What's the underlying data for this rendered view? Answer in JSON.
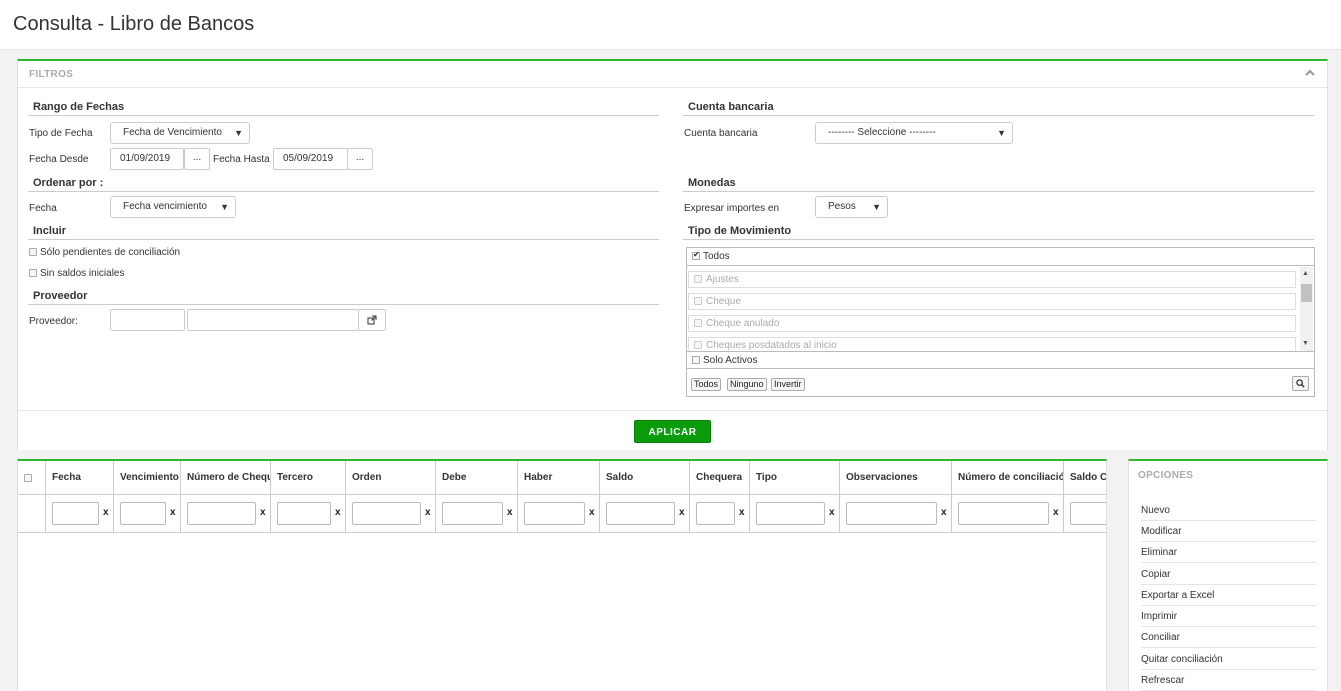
{
  "page": {
    "title": "Consulta - Libro de Bancos"
  },
  "filters": {
    "title": "FILTROS",
    "rango": {
      "title": "Rango de Fechas",
      "tipo_label": "Tipo de Fecha",
      "tipo_value": "Fecha de Vencimiento",
      "desde_label": "Fecha Desde",
      "desde_value": "01/09/2019",
      "hasta_label": "Fecha Hasta",
      "hasta_value": "05/09/2019",
      "dots": "..."
    },
    "ordenar": {
      "title": "Ordenar por :",
      "fecha_label": "Fecha",
      "fecha_value": "Fecha vencimiento"
    },
    "incluir": {
      "title": "Incluir",
      "pendientes": "Sólo pendientes de conciliación",
      "sin_saldos": "Sin saldos iniciales"
    },
    "proveedor": {
      "title": "Proveedor",
      "label": "Proveedor:"
    },
    "cuenta": {
      "title": "Cuenta bancaria",
      "label": "Cuenta bancaria",
      "value": "-------- Seleccione --------"
    },
    "monedas": {
      "title": "Monedas",
      "label": "Expresar importes en",
      "value": "Pesos"
    },
    "movimiento": {
      "title": "Tipo de Movimiento",
      "todos": "Todos",
      "items": [
        "Ajustes",
        "Cheque",
        "Cheque anulado",
        "Cheques posdatados al inicio"
      ],
      "solo_activos": "Solo Activos",
      "btn_todos": "Todos",
      "btn_ninguno": "Ninguno",
      "btn_invertir": "Invertir"
    },
    "apply": "APLICAR"
  },
  "grid": {
    "columns": [
      "Fecha",
      "Vencimiento",
      "Número de Cheque",
      "Tercero",
      "Orden",
      "Debe",
      "Haber",
      "Saldo",
      "Chequera",
      "Tipo",
      "Observaciones",
      "Número de conciliación",
      "Saldo Conciliado"
    ],
    "clear": "x"
  },
  "options": {
    "title": "OPCIONES",
    "items": [
      "Nuevo",
      "Modificar",
      "Eliminar",
      "Copiar",
      "Exportar a Excel",
      "Imprimir",
      "Conciliar",
      "Quitar conciliación",
      "Refrescar"
    ]
  }
}
